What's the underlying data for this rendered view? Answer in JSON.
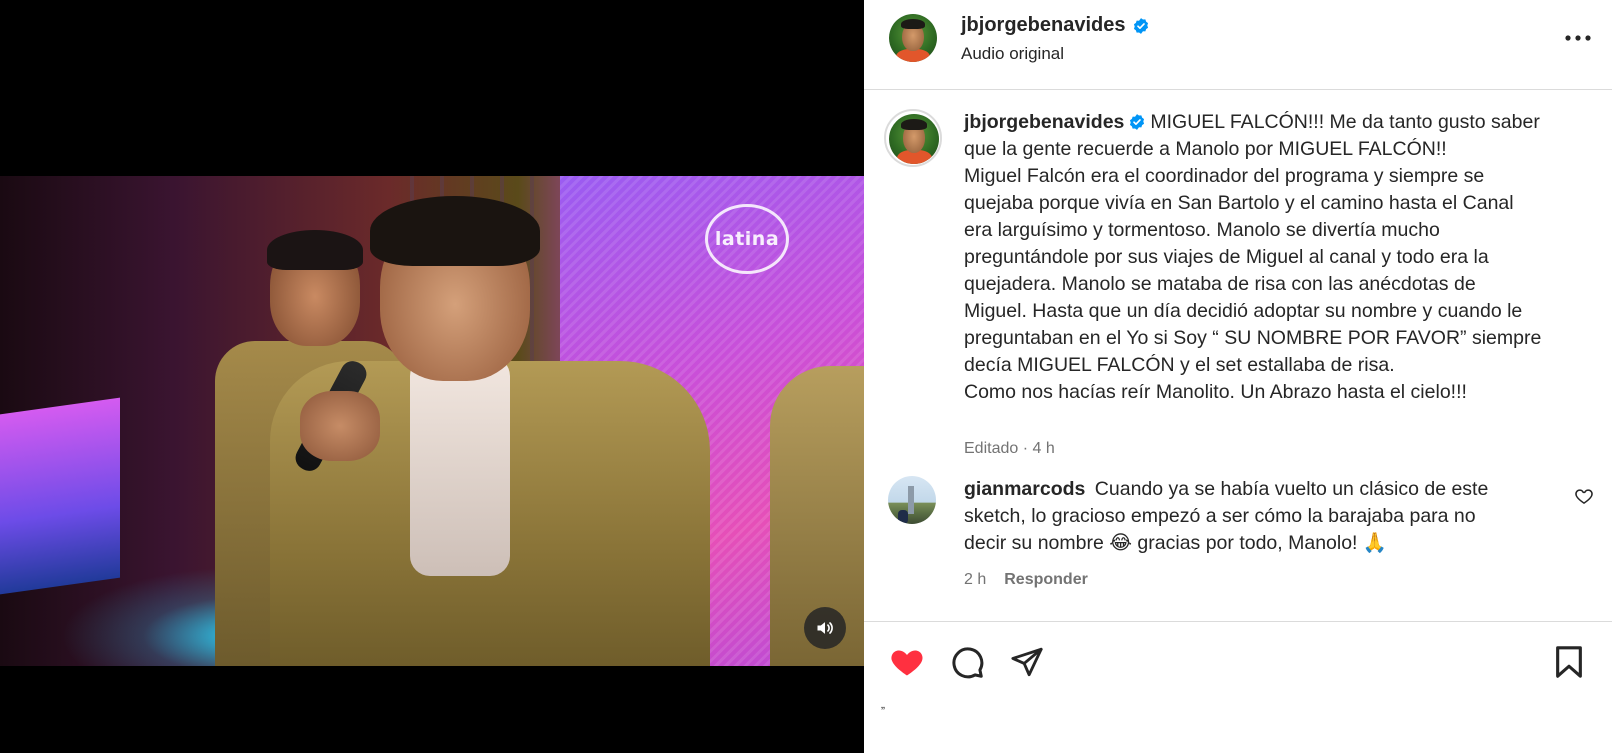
{
  "media": {
    "channel_logo_text": "latina",
    "sound_icon": "speaker-icon"
  },
  "post": {
    "username": "jbjorgebenavides",
    "verified": true,
    "audio_label": "Audio original",
    "more_icon": "more-options-icon"
  },
  "caption": {
    "username": "jbjorgebenavides",
    "lines": [
      "MIGUEL FALCÓN!!! Me da tanto gusto saber",
      "que la gente recuerde a Manolo por MIGUEL FALCÓN!!",
      "Miguel Falcón era el coordinador del programa y siempre se",
      "quejaba porque vivía en San Bartolo y el camino hasta el Canal",
      "era larguísimo y tormentoso. Manolo se divertía mucho",
      "preguntándole por sus viajes de Miguel al canal y todo era la",
      "quejadera. Manolo se mataba de risa con las anécdotas de",
      "Miguel. Hasta que un día decidió adoptar su nombre y cuando le",
      "preguntaban en el Yo si Soy “ SU NOMBRE POR FAVOR” siempre",
      "decía MIGUEL FALCÓN y el set estallaba de risa.",
      "Como nos hacías reír Manolito. Un Abrazo hasta el cielo!!!"
    ],
    "meta": "Editado · 4 h"
  },
  "comment": {
    "username": "gianmarcods",
    "lines": [
      "Cuando ya se había vuelto un clásico de este",
      "sketch, lo gracioso empezó a ser cómo la barajaba para no",
      "decir su nombre 😂 gracias por todo, Manolo! 🙏"
    ],
    "time": "2 h",
    "reply_label": "Responder"
  },
  "actions": {
    "liked": true,
    "like_color": "#ff3040",
    "tiny_mark": "„"
  }
}
